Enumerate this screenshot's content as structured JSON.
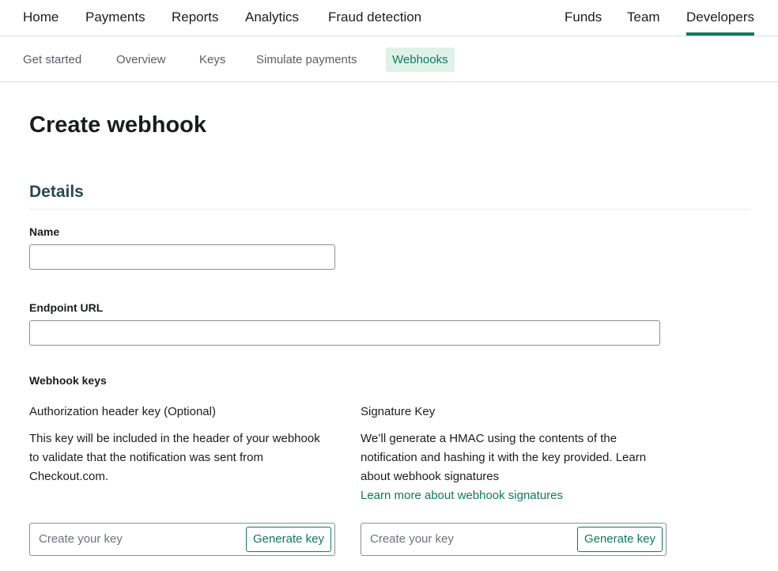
{
  "topnav": {
    "left": [
      "Home",
      "Payments",
      "Reports",
      "Analytics",
      "Fraud detection"
    ],
    "right": [
      "Funds",
      "Team",
      "Developers"
    ],
    "active": "Developers"
  },
  "subnav": {
    "items": [
      "Get started",
      "Overview",
      "Keys",
      "Simulate payments",
      "Webhooks"
    ],
    "active": "Webhooks"
  },
  "page": {
    "title": "Create webhook",
    "section_title": "Details"
  },
  "form": {
    "name_label": "Name",
    "name_value": "",
    "endpoint_label": "Endpoint URL",
    "endpoint_value": "",
    "webhook_keys_label": "Webhook keys",
    "auth": {
      "title": "Authorization header key (Optional)",
      "desc_lines": [
        "This key will be included in the header of your webhook",
        "to validate that the notification was sent from",
        "Checkout.com."
      ],
      "placeholder": "Create your key",
      "button": "Generate key"
    },
    "signature": {
      "title": "Signature Key",
      "desc_lines": [
        "We’ll generate a HMAC using the contents of the",
        "notification and hashing it with the key provided. Learn",
        "about webhook signatures"
      ],
      "link": "Learn more about webhook signatures",
      "placeholder": "Create your key",
      "button": "Generate key"
    }
  },
  "colors": {
    "accent": "#0f7a5c",
    "tab_bg": "#dff2ea"
  }
}
